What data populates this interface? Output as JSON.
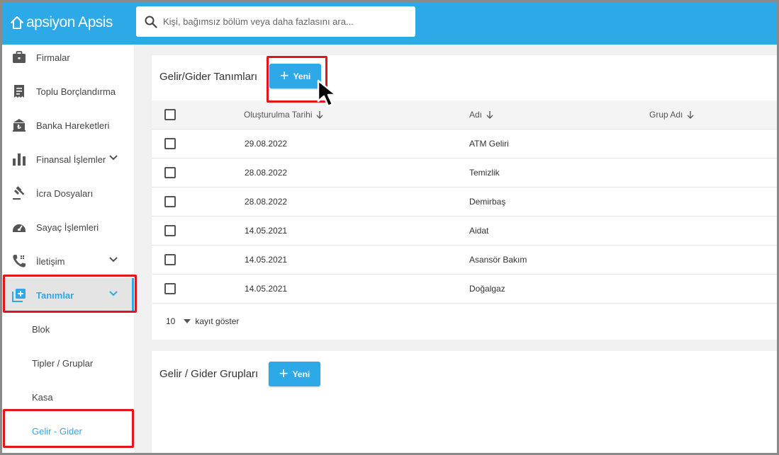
{
  "header": {
    "logo_text": "apsiyon Apsis",
    "search_placeholder": "Kişi, bağımsız bölüm veya daha fazlasını ara...",
    "brand_color": "#2ca9e6"
  },
  "sidebar": {
    "items": [
      {
        "label": "Firmalar",
        "icon": "briefcase-icon"
      },
      {
        "label": "Toplu Borçlandırma",
        "icon": "receipt-icon"
      },
      {
        "label": "Banka Hareketleri",
        "icon": "bank-icon"
      },
      {
        "label": "Finansal İşlemler",
        "icon": "bar-chart-icon",
        "expandable": true
      },
      {
        "label": "İcra Dosyaları",
        "icon": "gavel-icon"
      },
      {
        "label": "Sayaç İşlemleri",
        "icon": "meter-icon"
      },
      {
        "label": "İletişim",
        "icon": "phone-icon",
        "expandable": true
      },
      {
        "label": "Tanımlar",
        "icon": "add-box-icon",
        "expandable": true,
        "active": true
      }
    ],
    "sub_items": [
      {
        "label": "Blok"
      },
      {
        "label": "Tipler / Gruplar"
      },
      {
        "label": "Kasa"
      },
      {
        "label": "Gelir - Gider",
        "active": true
      }
    ]
  },
  "main": {
    "section1": {
      "title": "Gelir/Gider Tanımları",
      "new_button": "Yeni",
      "columns": [
        "Oluşturulma Tarihi",
        "Adı",
        "Grup Adı"
      ],
      "rows": [
        {
          "date": "29.08.2022",
          "name": "ATM Geliri",
          "group": ""
        },
        {
          "date": "28.08.2022",
          "name": "Temizlik",
          "group": ""
        },
        {
          "date": "28.08.2022",
          "name": "Demirbaş",
          "group": ""
        },
        {
          "date": "14.05.2021",
          "name": "Aidat",
          "group": ""
        },
        {
          "date": "14.05.2021",
          "name": "Asansör Bakım",
          "group": ""
        },
        {
          "date": "14.05.2021",
          "name": "Doğalgaz",
          "group": ""
        }
      ],
      "page_size": "10",
      "page_size_label": "kayıt göster"
    },
    "section2": {
      "title": "Gelir / Gider Grupları",
      "new_button": "Yeni"
    }
  }
}
